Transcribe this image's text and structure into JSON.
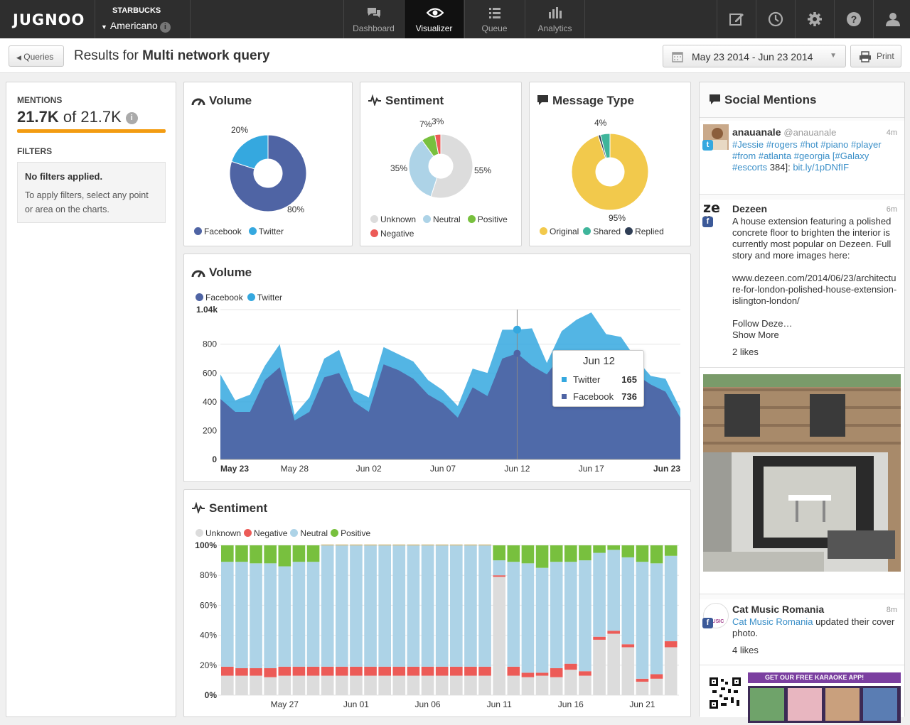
{
  "nav": {
    "logo": "JUGNOO",
    "org": "STARBUCKS",
    "product": "Americano",
    "tabs": [
      {
        "label": "Dashboard",
        "icon": "chat-bubbles-icon"
      },
      {
        "label": "Visualizer",
        "icon": "eye-icon"
      },
      {
        "label": "Queue",
        "icon": "list-icon"
      },
      {
        "label": "Analytics",
        "icon": "bar-chart-icon"
      }
    ],
    "active_tab": "Visualizer",
    "right_icons": [
      "edit-icon",
      "clock-icon",
      "gear-icon",
      "help-icon",
      "user-icon"
    ]
  },
  "subheader": {
    "back_label": "Queries",
    "title_prefix": "Results for",
    "title_query": "Multi network query",
    "date_range": "May 23 2014 - Jun 23 2014",
    "print_label": "Print"
  },
  "left": {
    "mentions_label": "MENTIONS",
    "mentions_count": "21.7K",
    "mentions_of": "of",
    "mentions_total": "21.7K",
    "mentions_progress_percent": 100,
    "filters_label": "FILTERS",
    "no_filters": "No filters applied.",
    "filters_help": "To apply filters, select any point or area on the charts."
  },
  "colors": {
    "facebook": "#4f64a4",
    "twitter": "#35a8df",
    "unknown": "#dcdcdc",
    "neutral": "#add3e7",
    "positive": "#78c03e",
    "negative": "#ec5b57",
    "original": "#f2c94c",
    "shared": "#3fb59b",
    "replied": "#2f3e55",
    "accent": "#f39c12"
  },
  "panels": {
    "volume_title": "Volume",
    "sentiment_title": "Sentiment",
    "message_type_title": "Message Type",
    "volume_chart_title": "Volume",
    "sentiment_chart_title": "Sentiment",
    "social_title": "Social Mentions"
  },
  "chart_data": [
    {
      "type": "pie",
      "title": "Volume",
      "labels": [
        "Facebook",
        "Twitter"
      ],
      "values": [
        80,
        20
      ],
      "value_labels": [
        "80%",
        "20%"
      ]
    },
    {
      "type": "pie",
      "title": "Sentiment",
      "labels": [
        "Unknown",
        "Neutral",
        "Positive",
        "Negative"
      ],
      "values": [
        55,
        35,
        7,
        3
      ],
      "value_labels": [
        "55%",
        "35%",
        "7%",
        "3%"
      ]
    },
    {
      "type": "pie",
      "title": "Message Type",
      "labels": [
        "Original",
        "Shared",
        "Replied"
      ],
      "values": [
        95,
        4,
        1
      ],
      "value_labels": [
        "95%",
        "4%"
      ]
    },
    {
      "type": "area",
      "title": "Volume",
      "stacked": true,
      "x": [
        "May 23",
        "May 24",
        "May 25",
        "May 26",
        "May 27",
        "May 28",
        "May 29",
        "May 30",
        "May 31",
        "Jun 01",
        "Jun 02",
        "Jun 03",
        "Jun 04",
        "Jun 05",
        "Jun 06",
        "Jun 07",
        "Jun 08",
        "Jun 09",
        "Jun 10",
        "Jun 11",
        "Jun 12",
        "Jun 13",
        "Jun 14",
        "Jun 15",
        "Jun 16",
        "Jun 17",
        "Jun 18",
        "Jun 19",
        "Jun 20",
        "Jun 21",
        "Jun 22",
        "Jun 23"
      ],
      "series": [
        {
          "name": "Facebook",
          "values": [
            420,
            330,
            330,
            550,
            640,
            270,
            330,
            570,
            600,
            400,
            330,
            660,
            620,
            560,
            450,
            390,
            290,
            500,
            440,
            700,
            736,
            650,
            590,
            730,
            720,
            570,
            560,
            760,
            590,
            520,
            470,
            290
          ]
        },
        {
          "name": "Twitter",
          "values": [
            170,
            80,
            120,
            100,
            160,
            40,
            100,
            130,
            160,
            80,
            100,
            120,
            110,
            120,
            100,
            90,
            80,
            130,
            160,
            200,
            165,
            260,
            80,
            160,
            250,
            450,
            310,
            90,
            110,
            60,
            90,
            60
          ]
        }
      ],
      "ylim": [
        0,
        1040
      ],
      "yticks": [
        "0",
        "200",
        "400",
        "600",
        "800",
        "1.04k"
      ],
      "xticks": [
        "May 23",
        "May 28",
        "Jun 02",
        "Jun 07",
        "Jun 12",
        "Jun 17",
        "Jun 23"
      ],
      "tooltip": {
        "title": "Jun 12",
        "rows": [
          {
            "name": "Twitter",
            "value": "165"
          },
          {
            "name": "Facebook",
            "value": "736"
          }
        ]
      }
    },
    {
      "type": "bar",
      "title": "Sentiment",
      "stacked": true,
      "percent": true,
      "categories": [
        "May 23",
        "May 24",
        "May 25",
        "May 26",
        "May 27",
        "May 28",
        "May 29",
        "May 30",
        "May 31",
        "Jun 01",
        "Jun 02",
        "Jun 03",
        "Jun 04",
        "Jun 05",
        "Jun 06",
        "Jun 07",
        "Jun 08",
        "Jun 09",
        "Jun 10",
        "Jun 11",
        "Jun 12",
        "Jun 13",
        "Jun 14",
        "Jun 15",
        "Jun 16",
        "Jun 17",
        "Jun 18",
        "Jun 19",
        "Jun 20",
        "Jun 21",
        "Jun 22",
        "Jun 23"
      ],
      "series": [
        {
          "name": "Unknown",
          "values": [
            13,
            13,
            13,
            12,
            13,
            13,
            13,
            13,
            13,
            13,
            13,
            13,
            13,
            13,
            13,
            13,
            13,
            13,
            13,
            79,
            13,
            12,
            13,
            12,
            17,
            13,
            37,
            41,
            32,
            9,
            11,
            32
          ]
        },
        {
          "name": "Negative",
          "values": [
            6,
            5,
            5,
            6,
            6,
            6,
            6,
            6,
            6,
            6,
            6,
            6,
            6,
            6,
            6,
            6,
            6,
            6,
            6,
            1,
            6,
            3,
            2,
            6,
            4,
            3,
            2,
            2,
            2,
            2,
            3,
            4
          ]
        },
        {
          "name": "Neutral",
          "values": [
            70,
            71,
            70,
            70,
            67,
            70,
            70,
            81,
            81,
            81,
            81,
            81,
            81,
            81,
            81,
            81,
            81,
            81,
            81,
            10,
            70,
            73,
            70,
            71,
            68,
            74,
            56,
            54,
            58,
            78,
            74,
            57
          ]
        },
        {
          "name": "Positive",
          "values": [
            11,
            11,
            12,
            12,
            14,
            11,
            11,
            0,
            0,
            0,
            0,
            0,
            0,
            0,
            0,
            0,
            0,
            0,
            0,
            10,
            11,
            12,
            15,
            11,
            11,
            10,
            5,
            3,
            8,
            11,
            12,
            7
          ]
        }
      ],
      "ylim": [
        0,
        100
      ],
      "yticks": [
        "0%",
        "20%",
        "40%",
        "60%",
        "80%",
        "100%"
      ],
      "xticks": [
        "May 27",
        "Jun 01",
        "Jun 06",
        "Jun 11",
        "Jun 16",
        "Jun 21"
      ]
    }
  ],
  "social": {
    "posts": [
      {
        "name": "anauanale",
        "handle": "@anauanale",
        "time": "4m",
        "network": "twitter",
        "text_tags": "#Jessie #rogers #hot #piano #player #from #atlanta #georgia [#Galaxy #escorts",
        "text_rest": "384]:",
        "link": "bit.ly/1pDNfIF"
      },
      {
        "name": "Dezeen",
        "time": "6m",
        "network": "facebook",
        "text": "A house extension featuring a polished concrete floor to brighten the interior is currently most popular on Dezeen. Full story and more images here:",
        "link": "www.dezeen.com/2014/06/23/architecture-for-london-polished-house-extension-islington-london/",
        "follow": "Follow Deze…",
        "show_more": "Show More",
        "likes": "2 likes",
        "avatar_text": "ze\nn"
      },
      {
        "name": "Cat Music Romania",
        "time": "8m",
        "network": "facebook",
        "link_name": "Cat Music Romania",
        "text": "updated their cover photo.",
        "likes": "4 likes",
        "banner": "GET OUR FREE KARAOKE APP!",
        "avatar_text": "MUSIC"
      }
    ]
  }
}
